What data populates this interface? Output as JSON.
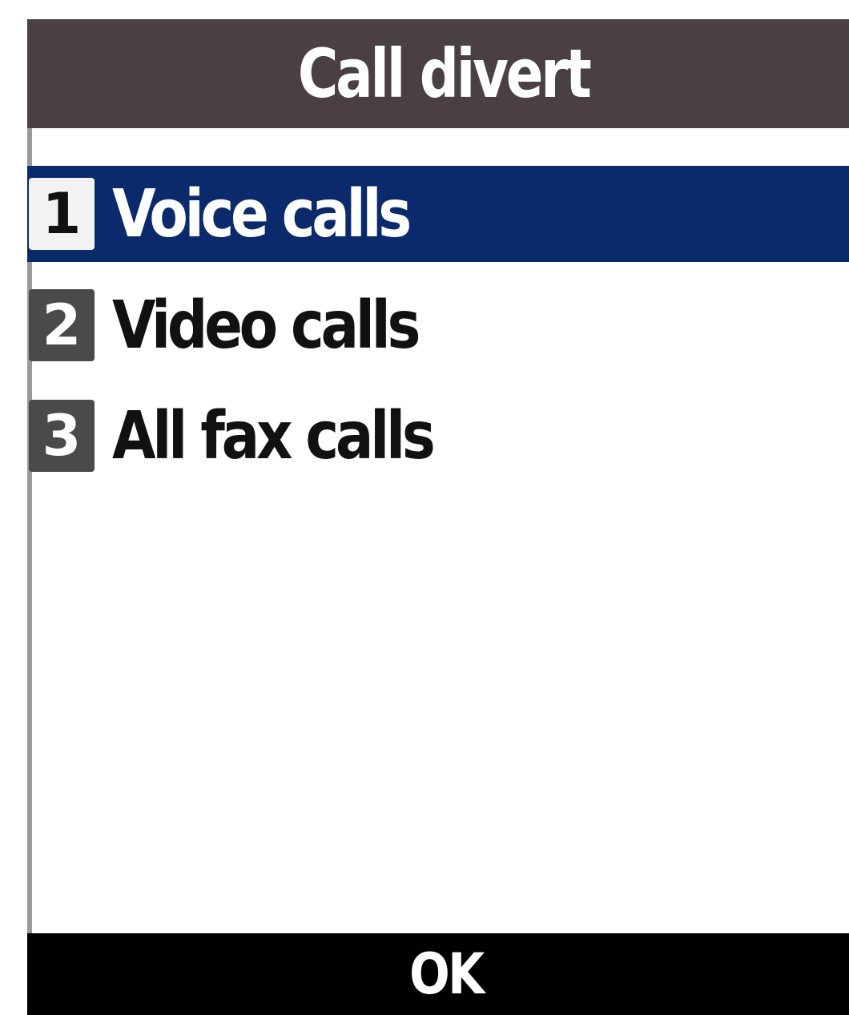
{
  "screen": {
    "title": "Call divert"
  },
  "menu": {
    "items": [
      {
        "number": "1",
        "label": "Voice calls",
        "selected": true
      },
      {
        "number": "2",
        "label": "Video calls",
        "selected": false
      },
      {
        "number": "3",
        "label": "All fax calls",
        "selected": false
      }
    ]
  },
  "softkeys": {
    "center_label": "OK"
  },
  "colors": {
    "titlebar": "#4a4043",
    "selection": "#0a2a6b",
    "softkey_bar": "#000000"
  }
}
